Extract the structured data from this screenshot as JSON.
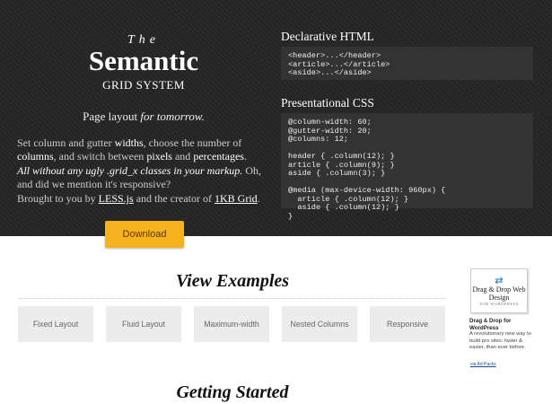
{
  "hero": {
    "logo_the": "The",
    "logo_main": "Semantic",
    "logo_sub": "GRID SYSTEM",
    "tagline_a": "Page layout ",
    "tagline_b": "for tomorrow.",
    "p1": {
      "t1": "Set column and gutter ",
      "b1": "widths",
      "t2": ", choose the number of ",
      "b2": "columns",
      "t3": ", and switch between ",
      "b3": "pixels",
      "t4": " and ",
      "b4": "percentages",
      "t5": "."
    },
    "p2": {
      "i1": "All without any ugly .grid_x classes in your markup.",
      "t1": " Oh, and did we mention it's responsive?"
    },
    "p3": {
      "t1": "Brought to you by ",
      "l1": "LESS.js",
      "t2": " and the creator of ",
      "l2": "1KB Grid",
      "t3": "."
    },
    "download_label": "Download"
  },
  "code": {
    "html_title": "Declarative HTML",
    "html_code": "<header>...</header>\n<article>...</article>\n<aside>...</aside>",
    "css_title": "Presentational CSS",
    "css_code": "@column-width: 60;\n@gutter-width: 20;\n@columns: 12;\n\nheader { .column(12); }\narticle { .column(9); }\naside { .column(3); }\n\n@media (max-device-width: 960px) {\n  article { .column(12); }\n  aside { .column(12); }\n}"
  },
  "examples": {
    "heading": "View Examples",
    "tiles": [
      "Fixed Layout",
      "Fluid Layout",
      "Maximum-width",
      "Nested Columns",
      "Responsive"
    ]
  },
  "getting_started": {
    "heading": "Getting Started"
  },
  "ad": {
    "box_title": "Drag & Drop Web Design",
    "box_small": "FOR WORDPRESS",
    "heading": "Drag & Drop for WordPress",
    "text": "A revolutionary new way to build pro sites: faster & easier, than ever before.",
    "link": "via Ad Packs"
  },
  "colors": {
    "hero_bg": "#252525",
    "download": "#f5b21e",
    "tile_bg": "#ececec"
  }
}
